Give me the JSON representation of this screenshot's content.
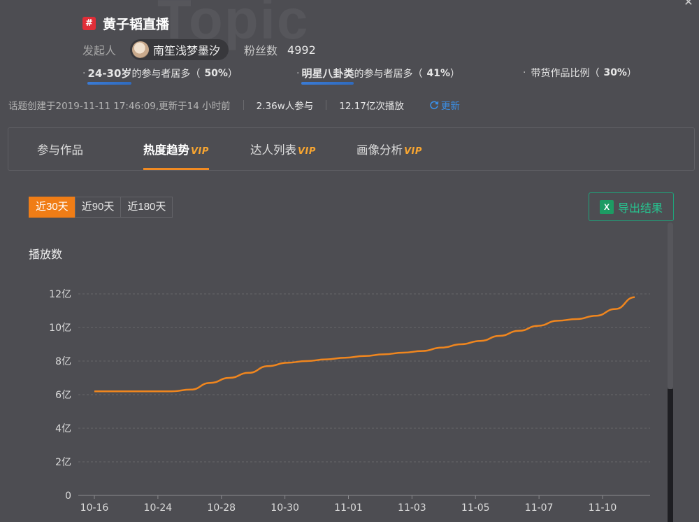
{
  "watermark": "Topic",
  "header": {
    "badge_symbol": "#",
    "topic_title": "黄子韬直播",
    "initiator_label": "发起人",
    "initiator_name": "南笙浅梦墨汐",
    "fans_label": "粉丝数",
    "fans_value": "4992"
  },
  "stats": [
    {
      "dot": "·",
      "highlight": "24-30岁",
      "text": "的参与者居多（",
      "pct": "50%",
      "close": "）"
    },
    {
      "dot": "·",
      "highlight": "明星八卦类",
      "text": "的参与者居多（",
      "pct": "41%",
      "close": "）"
    },
    {
      "dot": "·",
      "highlight": "",
      "text": "带货作品比例（",
      "pct": "30%",
      "close": "）"
    }
  ],
  "meta": {
    "created": "话题创建于2019-11-11 17:46:09,更新于14 小时前",
    "participants": "2.36w人参与",
    "plays": "12.17亿次播放",
    "refresh_label": "更新"
  },
  "tabs": [
    {
      "label": "参与作品",
      "vip": ""
    },
    {
      "label": "热度趋势",
      "vip": "VIP"
    },
    {
      "label": "达人列表",
      "vip": "VIP"
    },
    {
      "label": "画像分析",
      "vip": "VIP"
    }
  ],
  "period_buttons": [
    "近30天",
    "近90天",
    "近180天"
  ],
  "export_label": "导出结果",
  "colors": {
    "accent": "#f07d16",
    "line": "#f0861e",
    "export": "#27c28f",
    "link": "#3b8fe6"
  },
  "chart_data": {
    "type": "line",
    "ylabel": "播放数",
    "y_ticks": [
      "0",
      "2亿",
      "4亿",
      "6亿",
      "8亿",
      "10亿",
      "12亿"
    ],
    "ylim": [
      0,
      12
    ],
    "x_ticks": [
      "10-16",
      "10-24",
      "10-28",
      "10-30",
      "11-01",
      "11-03",
      "11-05",
      "11-07",
      "11-10"
    ],
    "grid": true,
    "series": [
      {
        "values": [
          6.2,
          6.2,
          6.2,
          6.2,
          6.2,
          6.3,
          6.7,
          7.0,
          7.3,
          7.7,
          7.9,
          8.0,
          8.1,
          8.2,
          8.3,
          8.4,
          8.5,
          8.6,
          8.8,
          9.0,
          9.2,
          9.5,
          9.8,
          10.1,
          10.4,
          10.5,
          10.7,
          11.1,
          11.8
        ]
      }
    ]
  }
}
